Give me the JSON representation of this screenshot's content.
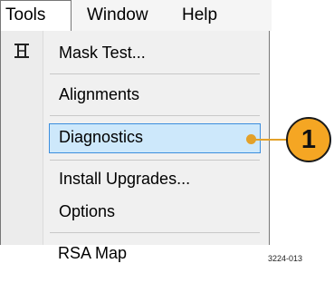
{
  "menubar": {
    "items": [
      {
        "label": "Tools"
      },
      {
        "label": "Window"
      },
      {
        "label": "Help"
      }
    ]
  },
  "tools_menu": {
    "items": [
      {
        "label": "Mask Test...",
        "icon": "mask-test-icon"
      },
      {
        "label": "Alignments"
      },
      {
        "label": "Diagnostics",
        "highlighted": true
      },
      {
        "label": "Install Upgrades..."
      },
      {
        "label": "Options"
      },
      {
        "label": "RSA Map"
      }
    ]
  },
  "callout": {
    "number": "1",
    "color": "#f5a623"
  },
  "figure_id": "3224-013",
  "colors": {
    "highlight_fill": "#cde8fb",
    "highlight_border": "#3c8ede",
    "callout_leader": "#e3a129"
  }
}
